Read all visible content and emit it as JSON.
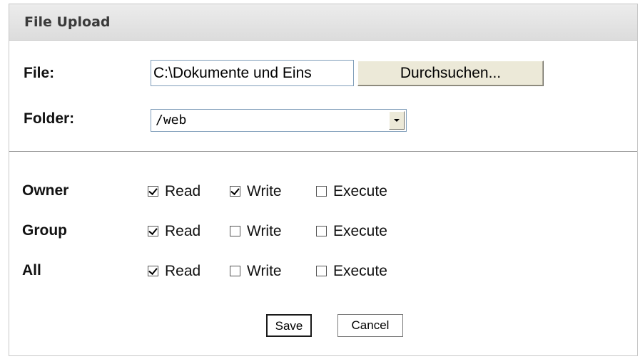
{
  "panel": {
    "title": "File Upload"
  },
  "file": {
    "label": "File:",
    "value": "C:\\Dokumente und Eins",
    "browse_label": "Durchsuchen..."
  },
  "folder": {
    "label": "Folder:",
    "selected": "/web"
  },
  "permissions": {
    "owner": {
      "label": "Owner",
      "options": [
        {
          "label": "Read",
          "checked": true
        },
        {
          "label": "Write",
          "checked": true
        },
        {
          "label": "Execute",
          "checked": false
        }
      ]
    },
    "group": {
      "label": "Group",
      "options": [
        {
          "label": "Read",
          "checked": true
        },
        {
          "label": "Write",
          "checked": false
        },
        {
          "label": "Execute",
          "checked": false
        }
      ]
    },
    "all": {
      "label": "All",
      "options": [
        {
          "label": "Read",
          "checked": true
        },
        {
          "label": "Write",
          "checked": false
        },
        {
          "label": "Execute",
          "checked": false
        }
      ]
    }
  },
  "actions": {
    "save_label": "Save",
    "cancel_label": "Cancel"
  }
}
